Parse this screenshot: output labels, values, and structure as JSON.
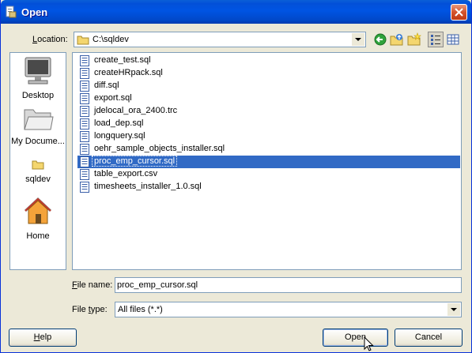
{
  "window": {
    "title": "Open",
    "title_icon": "document-open-icon",
    "close_icon": "close-icon"
  },
  "location": {
    "label": "Location:",
    "label_access_key": "L",
    "label_rest": "ocation:",
    "value": "C:\\sqldev",
    "folder_icon": "folder-icon"
  },
  "toolbar": {
    "buttons": [
      {
        "icon": "back-arrow-icon"
      },
      {
        "icon": "up-folder-icon"
      },
      {
        "icon": "new-folder-icon"
      },
      {
        "icon": "list-view-icon",
        "active": true
      },
      {
        "icon": "details-view-icon"
      }
    ]
  },
  "places": [
    {
      "label": "Desktop",
      "icon": "desktop-icon"
    },
    {
      "label": "My Docume...",
      "icon": "folder-open-icon"
    },
    {
      "label": "sqldev",
      "icon": "folder-icon"
    },
    {
      "label": "Home",
      "icon": "home-icon"
    }
  ],
  "files": [
    {
      "name": "create_test.sql"
    },
    {
      "name": "createHRpack.sql"
    },
    {
      "name": "diff.sql"
    },
    {
      "name": "export.sql"
    },
    {
      "name": "jdelocal_ora_2400.trc"
    },
    {
      "name": "load_dep.sql"
    },
    {
      "name": "longquery.sql"
    },
    {
      "name": "oehr_sample_objects_installer.sql"
    },
    {
      "name": "proc_emp_cursor.sql",
      "selected": true
    },
    {
      "name": "table_export.csv"
    },
    {
      "name": "timesheets_installer_1.0.sql"
    }
  ],
  "file_name": {
    "label_access_key": "F",
    "label_rest": "ile name:",
    "value": "proc_emp_cursor.sql"
  },
  "file_type": {
    "label_pre": "File ",
    "label_access_key": "t",
    "label_rest": "ype:",
    "value": "All files (*.*)"
  },
  "buttons": {
    "help_key": "H",
    "help_rest": "elp",
    "open_label": "Open",
    "cancel_label": "Cancel"
  },
  "colors": {
    "selection": "#316ac5",
    "titlebar": "#0054e3",
    "dialog_bg": "#ece9d8"
  }
}
